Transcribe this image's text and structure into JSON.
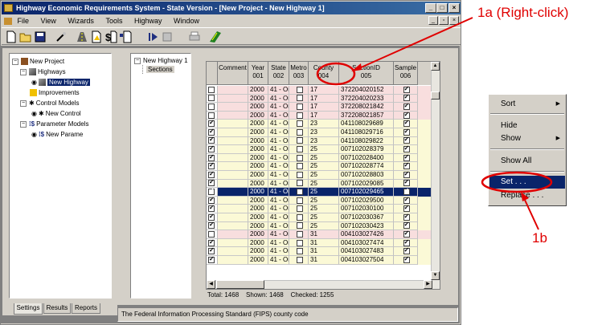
{
  "window": {
    "title": "Highway Economic Requirements System - State Version - [New Project - New Highway 1]",
    "min_label": "_",
    "max_label": "□",
    "close_label": "×"
  },
  "menu": {
    "items": [
      "File",
      "View",
      "Wizards",
      "Tools",
      "Highway",
      "Window"
    ],
    "mdi_min": "_",
    "mdi_restore": "▫",
    "mdi_close": "×"
  },
  "toolbar": {
    "buttons": [
      "new-icon",
      "open-icon",
      "save-icon",
      "wand-icon",
      "highway-icon",
      "improvement-icon",
      "cost-icon",
      "parameter-icon",
      "run-icon",
      "stop-icon",
      "print-icon",
      "map-icon"
    ]
  },
  "tree": {
    "root": "New Project",
    "highways": "Highways",
    "highway_item": "New Highway",
    "improvements": "Improvements",
    "control_models": "Control Models",
    "control_item": "New Control",
    "parameter_models": "Parameter Models",
    "parameter_item": "New Parame"
  },
  "left_tabs": [
    "Settings",
    "Results",
    "Reports"
  ],
  "sections_tree": {
    "root": "New Highway 1",
    "child": "Sections"
  },
  "grid": {
    "headers": [
      {
        "l1": "",
        "l2": ""
      },
      {
        "l1": "Comment",
        "l2": ""
      },
      {
        "l1": "Year",
        "l2": "001"
      },
      {
        "l1": "State",
        "l2": "002"
      },
      {
        "l1": "Metro",
        "l2": "003"
      },
      {
        "l1": "County",
        "l2": "004"
      },
      {
        "l1": "SectionID",
        "l2": "005"
      },
      {
        "l1": "Sample",
        "l2": "006"
      }
    ],
    "rows": [
      {
        "checked": false,
        "year": "2000",
        "state": "41 - Or",
        "metro": false,
        "county": "17",
        "section": "372204020152",
        "sample": true,
        "tint": "pink"
      },
      {
        "checked": false,
        "year": "2000",
        "state": "41 - Or",
        "metro": false,
        "county": "17",
        "section": "372204020233",
        "sample": true,
        "tint": "pink"
      },
      {
        "checked": false,
        "year": "2000",
        "state": "41 - Or",
        "metro": false,
        "county": "17",
        "section": "372208021842",
        "sample": true,
        "tint": "pink"
      },
      {
        "checked": false,
        "year": "2000",
        "state": "41 - Or",
        "metro": false,
        "county": "17",
        "section": "372208021857",
        "sample": true,
        "tint": "pink"
      },
      {
        "checked": true,
        "year": "2000",
        "state": "41 - Or",
        "metro": false,
        "county": "23",
        "section": "041108029689",
        "sample": true,
        "tint": "yellow"
      },
      {
        "checked": true,
        "year": "2000",
        "state": "41 - Or",
        "metro": false,
        "county": "23",
        "section": "041108029716",
        "sample": true,
        "tint": "yellow"
      },
      {
        "checked": true,
        "year": "2000",
        "state": "41 - Or",
        "metro": false,
        "county": "23",
        "section": "041108029822",
        "sample": true,
        "tint": "yellow"
      },
      {
        "checked": true,
        "year": "2000",
        "state": "41 - Or",
        "metro": false,
        "county": "25",
        "section": "007102028379",
        "sample": true,
        "tint": "yellow"
      },
      {
        "checked": true,
        "year": "2000",
        "state": "41 - Or",
        "metro": false,
        "county": "25",
        "section": "007102028400",
        "sample": true,
        "tint": "yellow"
      },
      {
        "checked": true,
        "year": "2000",
        "state": "41 - Or",
        "metro": false,
        "county": "25",
        "section": "007102028774",
        "sample": true,
        "tint": "yellow"
      },
      {
        "checked": true,
        "year": "2000",
        "state": "41 - Or",
        "metro": false,
        "county": "25",
        "section": "007102028803",
        "sample": true,
        "tint": "yellow"
      },
      {
        "checked": true,
        "year": "2000",
        "state": "41 - Or",
        "metro": false,
        "county": "25",
        "section": "007102029085",
        "sample": true,
        "tint": "yellow"
      },
      {
        "checked": true,
        "year": "2000",
        "state": "41 - Or",
        "metro": false,
        "county": "25",
        "section": "007102029465",
        "sample": true,
        "tint": "selected"
      },
      {
        "checked": true,
        "year": "2000",
        "state": "41 - Or",
        "metro": false,
        "county": "25",
        "section": "007102029500",
        "sample": true,
        "tint": "yellow"
      },
      {
        "checked": true,
        "year": "2000",
        "state": "41 - Or",
        "metro": false,
        "county": "25",
        "section": "007102030100",
        "sample": true,
        "tint": "yellow"
      },
      {
        "checked": true,
        "year": "2000",
        "state": "41 - Or",
        "metro": false,
        "county": "25",
        "section": "007102030367",
        "sample": true,
        "tint": "yellow"
      },
      {
        "checked": true,
        "year": "2000",
        "state": "41 - Or",
        "metro": false,
        "county": "25",
        "section": "007102030423",
        "sample": true,
        "tint": "yellow"
      },
      {
        "checked": false,
        "year": "2000",
        "state": "41 - Or",
        "metro": false,
        "county": "31",
        "section": "004103027426",
        "sample": true,
        "tint": "pink"
      },
      {
        "checked": true,
        "year": "2000",
        "state": "41 - Or",
        "metro": false,
        "county": "31",
        "section": "004103027474",
        "sample": true,
        "tint": "yellow"
      },
      {
        "checked": true,
        "year": "2000",
        "state": "41 - Or",
        "metro": false,
        "county": "31",
        "section": "004103027483",
        "sample": true,
        "tint": "yellow"
      },
      {
        "checked": true,
        "year": "2000",
        "state": "41 - Or",
        "metro": false,
        "county": "31",
        "section": "004103027504",
        "sample": true,
        "tint": "yellow"
      }
    ],
    "colors": {
      "pink": "#f8dede",
      "yellow": "#fbf9d6",
      "selected": "#0a246a"
    }
  },
  "summary": {
    "total": "Total: 1468",
    "shown": "Shown: 1468",
    "checked": "Checked: 1255"
  },
  "status_text": "The Federal Information Processing Standard (FIPS) county code",
  "context_menu": {
    "items": [
      {
        "label": "Sort",
        "submenu": true
      },
      {
        "label": "Hide",
        "submenu": false
      },
      {
        "label": "Show",
        "submenu": true
      },
      {
        "label": "Show All",
        "submenu": false
      },
      {
        "label": "Set . . .",
        "submenu": false,
        "highlight": true
      },
      {
        "label": "Replace . . .",
        "submenu": false
      }
    ],
    "submenu_arrow": "▶"
  },
  "annotations": {
    "callout_1a": "1a (Right-click)",
    "callout_1b": "1b",
    "color": "#e00000"
  }
}
